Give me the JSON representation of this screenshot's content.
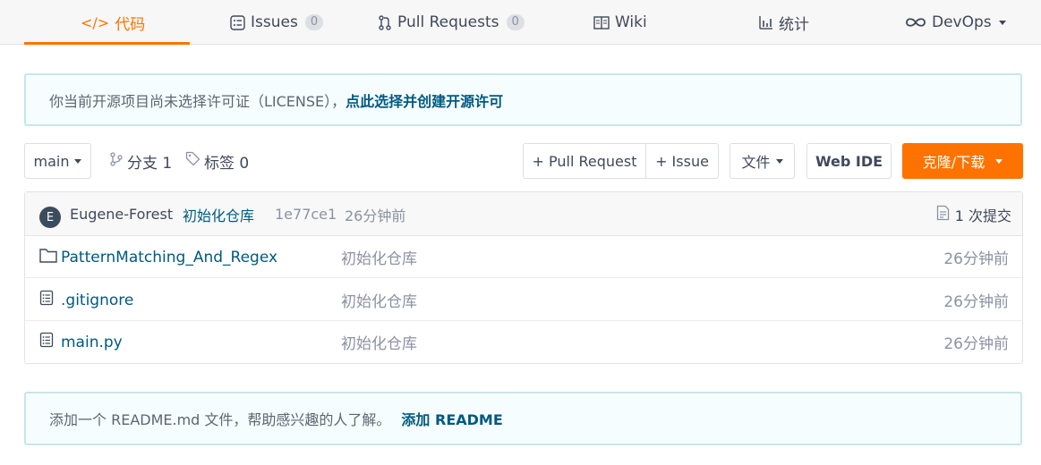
{
  "tabs": {
    "code": "代码",
    "issues": "Issues",
    "issues_count": "0",
    "pull_requests": "Pull Requests",
    "pull_requests_count": "0",
    "wiki": "Wiki",
    "stats": "统计",
    "devops": "DevOps"
  },
  "license_notice": {
    "text": "你当前开源项目尚未选择许可证（LICENSE），",
    "link": "点此选择并创建开源许可"
  },
  "toolbar": {
    "branch": "main",
    "branches_label": "分支 1",
    "tags_label": "标签 0",
    "pull_request_btn": "+ Pull Request",
    "issue_btn": "+ Issue",
    "file_btn": "文件",
    "web_ide_btn": "Web IDE",
    "clone_btn": "克隆/下载",
    "accent_color": "#fe7300"
  },
  "latest_commit": {
    "avatar_letter": "E",
    "author": "Eugene-Forest",
    "message": "初始化仓库",
    "sha": "1e77ce1",
    "time": "26分钟前",
    "commit_count": "1 次提交"
  },
  "files": [
    {
      "icon": "folder-icon",
      "name": "PatternMatching_And_Regex",
      "message": "初始化仓库",
      "time": "26分钟前"
    },
    {
      "icon": "file-icon",
      "name": ".gitignore",
      "message": "初始化仓库",
      "time": "26分钟前"
    },
    {
      "icon": "file-icon",
      "name": "main.py",
      "message": "初始化仓库",
      "time": "26分钟前"
    }
  ],
  "readme_notice": {
    "text": "添加一个 README.md 文件，帮助感兴趣的人了解。",
    "link": "添加 README"
  }
}
